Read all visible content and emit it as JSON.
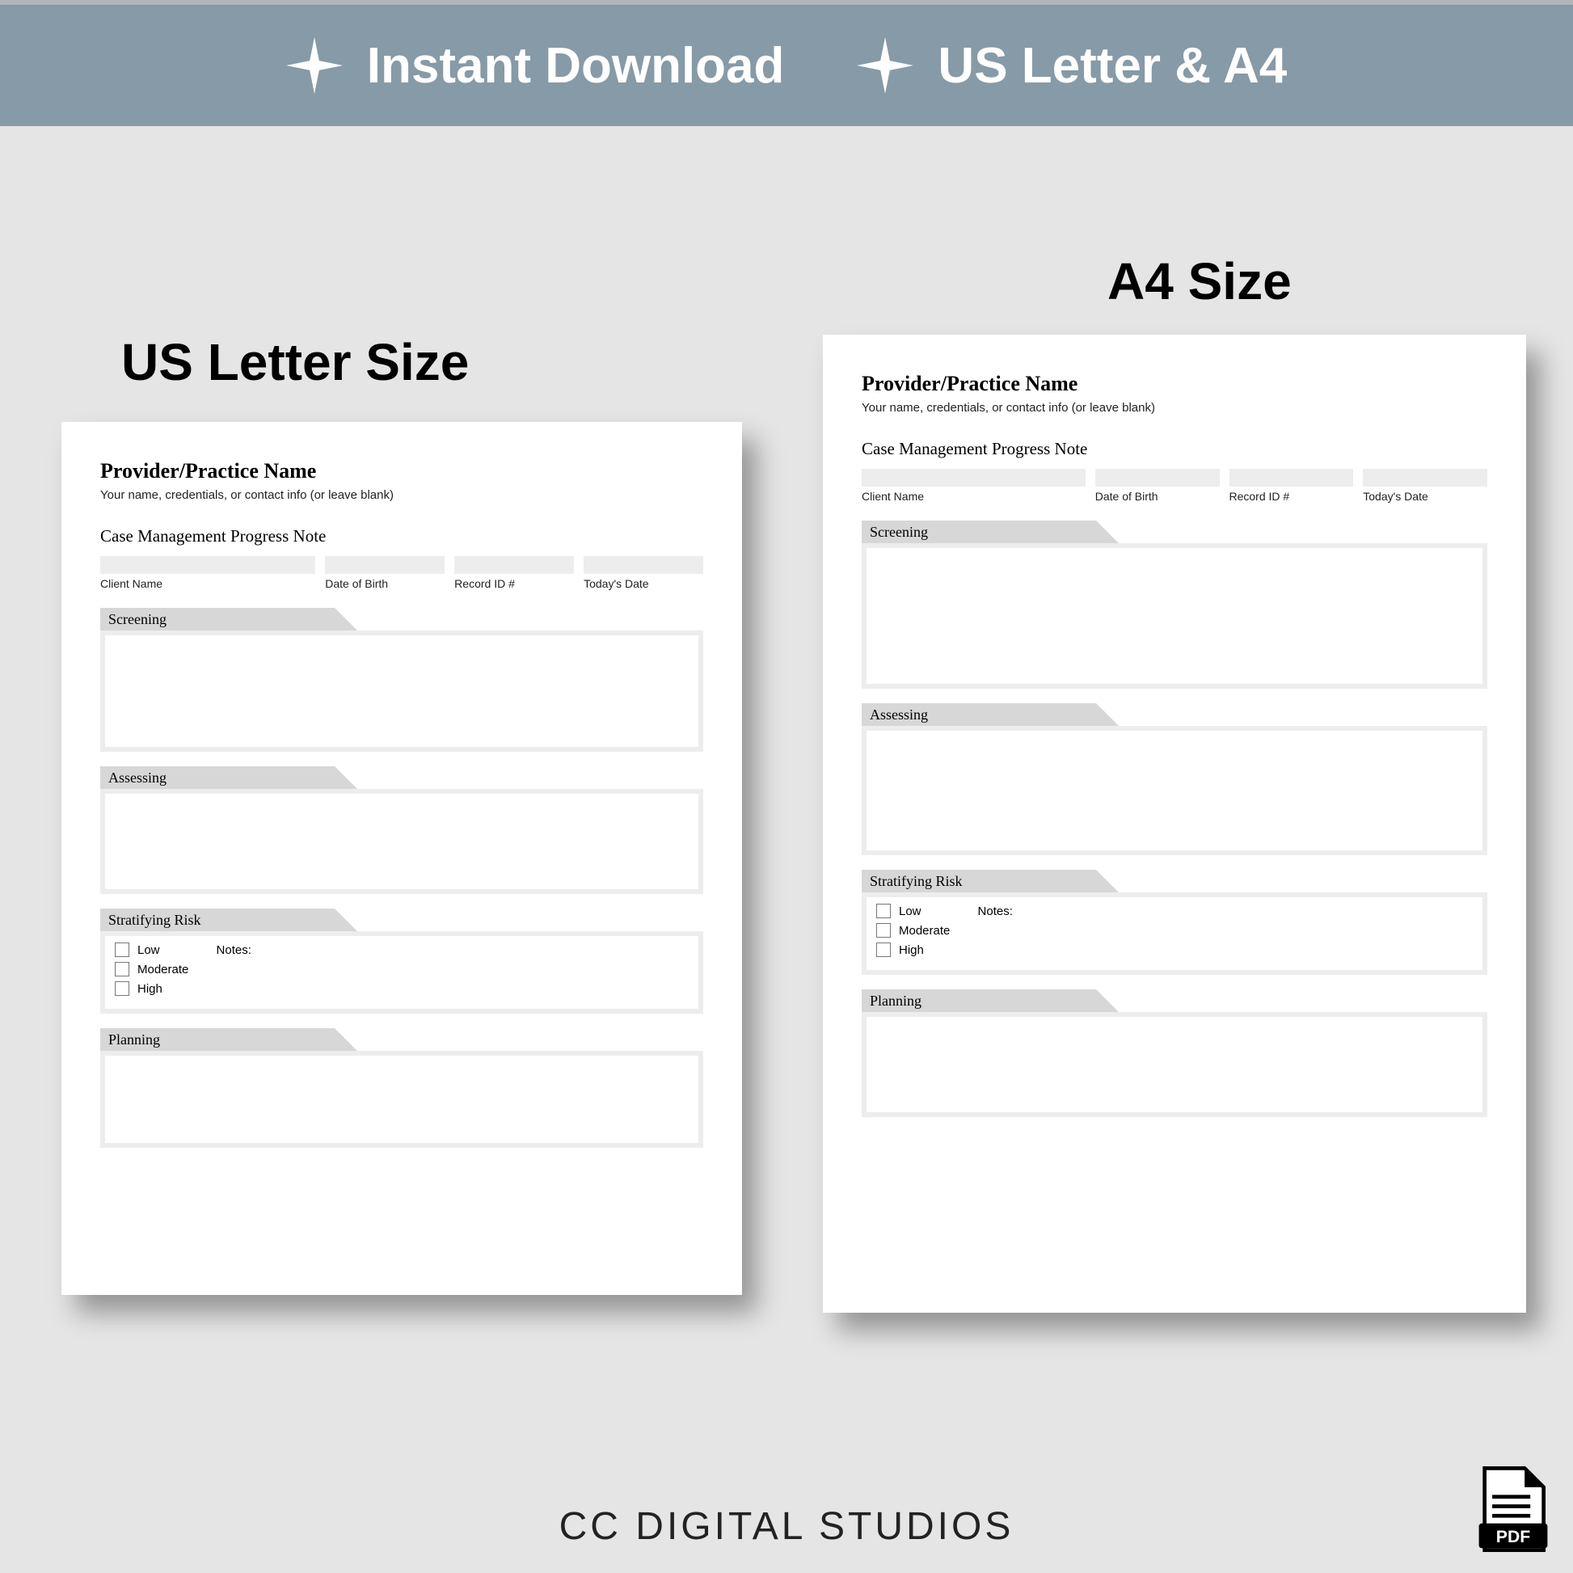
{
  "banner": {
    "item1": "Instant Download",
    "item2": "US Letter & A4"
  },
  "labels": {
    "us": "US Letter Size",
    "a4": "A4 Size"
  },
  "form": {
    "provider_name": "Provider/Practice Name",
    "provider_sub": "Your name, credentials, or contact info (or leave blank)",
    "title": "Case Management Progress Note",
    "fields": {
      "client": "Client Name",
      "dob": "Date of Birth",
      "record": "Record ID #",
      "date": "Today's Date"
    },
    "sections": {
      "screening": "Screening",
      "assessing": "Assessing",
      "risk": "Stratifying Risk",
      "planning": "Planning"
    },
    "risk_levels": {
      "low": "Low",
      "moderate": "Moderate",
      "high": "High",
      "notes": "Notes:"
    }
  },
  "footer": {
    "brand": "CC DIGITAL STUDIOS",
    "pdf": "PDF"
  }
}
